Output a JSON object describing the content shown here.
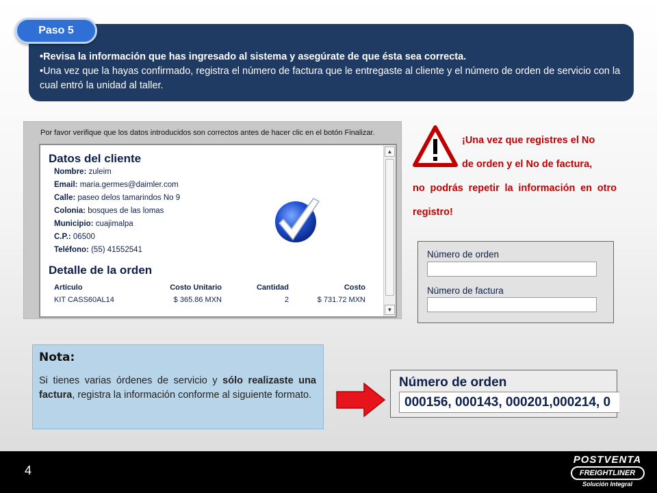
{
  "banner": {
    "step_label": "Paso 5",
    "bullet_1": "•Revisa la información que has ingresado al sistema y asegúrate de que ésta sea correcta.",
    "bullet_2": "•Una vez que la hayas confirmado, registra el número de factura que le entregaste al cliente y el número de orden de servicio con la cual entró la unidad al taller."
  },
  "screenshot": {
    "verify_text": "Por favor verifique que los datos introducidos son correctos antes de hacer clic en el botón Finalizar.",
    "client_title": "Datos del cliente",
    "fields": [
      {
        "label": "Nombre:",
        "value": " zuleim"
      },
      {
        "label": "Email:",
        "value": " maria.germes@daimler.com"
      },
      {
        "label": "Calle:",
        "value": " paseo delos tamarindos No 9"
      },
      {
        "label": "Colonia:",
        "value": " bosques de las lomas"
      },
      {
        "label": "Municipio:",
        "value": " cuajimalpa"
      },
      {
        "label": "C.P.:",
        "value": " 06500"
      },
      {
        "label": "Teléfono:",
        "value": " (55) 41552541"
      }
    ],
    "order_title": "Detalle de la orden",
    "table_headers": [
      "Artículo",
      "Costo Unitario",
      "Cantidad",
      "Costo"
    ],
    "table_rows": [
      [
        "KIT CASS60AL14",
        "$ 365.86 MXN",
        "2",
        "$ 731.72 MXN"
      ]
    ]
  },
  "warning": {
    "line_1": "¡Una vez que registres el No",
    "line_2": "de orden y el No de factura,",
    "line_3": "no podrás repetir la información en otro registro!"
  },
  "form": {
    "order_label": "Número de orden",
    "invoice_label": "Número de factura"
  },
  "nota": {
    "title": "Nota:",
    "text_1": "Si tienes varias órdenes de servicio y ",
    "text_bold": "sólo realizaste una factura",
    "text_2": ", registra la información conforme al siguiente formato."
  },
  "example": {
    "label": "Número de orden",
    "value": "000156, 000143, 000201,000214, 0"
  },
  "footer": {
    "page_number": "4",
    "logo_top": "POSTVENTA",
    "logo_brand": "FREIGHTLINER",
    "logo_bottom": "Solución Integral"
  },
  "colors": {
    "banner": "#1f3b63",
    "step_pill": "#2f6fd6",
    "warning_text": "#c00000",
    "arrow": "#e8141c",
    "nota_bg": "#b8d4e8"
  }
}
